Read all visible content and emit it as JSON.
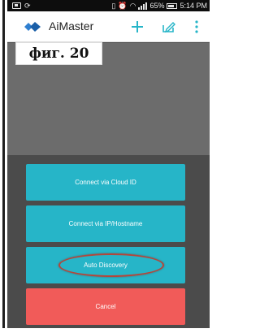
{
  "status_bar": {
    "battery_percent": "65%",
    "time": "5:14 PM"
  },
  "app_bar": {
    "title": "AiMaster",
    "icons": [
      "logo-icon",
      "add-icon",
      "edit-icon",
      "overflow-menu-icon"
    ]
  },
  "figure_label": "фиг. 20",
  "dialog": {
    "buttons": [
      {
        "label": "Connect via Cloud ID"
      },
      {
        "label": "Connect via IP/Hostname"
      },
      {
        "label": "Auto Discovery"
      },
      {
        "label": "Cancel"
      }
    ]
  },
  "colors": {
    "accent": "#26b5c8",
    "cancel": "#f15b59",
    "highlight": "#b4463a"
  }
}
